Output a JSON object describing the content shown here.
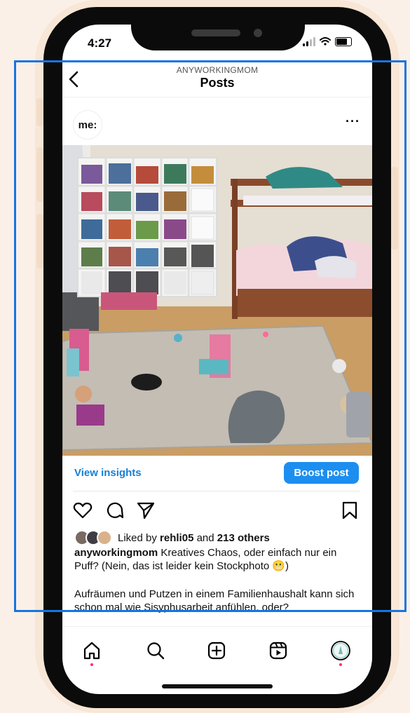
{
  "status_bar": {
    "time": "4:27"
  },
  "header": {
    "username": "ANYWORKINGMOM",
    "title": "Posts"
  },
  "post": {
    "avatar_text": "me:",
    "more_label": "···",
    "insights_label": "View insights",
    "boost_label": "Boost post",
    "likes": {
      "prefix": "Liked by",
      "user": "rehli05",
      "connector": "and",
      "others": "213 others"
    },
    "caption": {
      "author": "anyworkingmom",
      "text": "Kreatives Chaos, oder einfach nur ein Puff? (Nein, das ist leider kein Stockphoto 😬)",
      "second_paragraph": "Aufräumen und Putzen in einem Familienhaushalt kann sich schon mal wie Sisyphusarbeit anfühlen, oder?"
    }
  },
  "colors": {
    "accent": "#1c8ef0",
    "link": "#1580d6",
    "notification_dot": "#ff2d6a",
    "selection_box": "#1675e0"
  },
  "icons": {
    "back": "chevron-left-icon",
    "like": "heart-icon",
    "comment": "comment-icon",
    "share": "send-icon",
    "save": "bookmark-icon",
    "home": "home-icon",
    "search": "search-icon",
    "create": "plus-square-icon",
    "reels": "reels-icon",
    "profile": "profile-icon"
  }
}
